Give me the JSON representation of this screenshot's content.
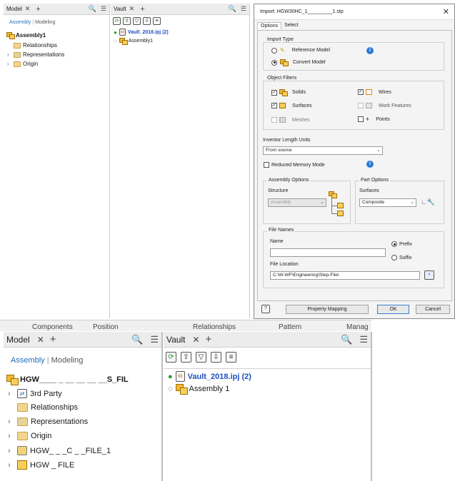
{
  "top": {
    "model_panel": {
      "tab_label": "Model",
      "modes": [
        "Assembly",
        "Modeling"
      ],
      "tree": [
        {
          "label": "Assembly1",
          "icon": "assembly-icon"
        },
        {
          "label": "Relationships",
          "icon": "folder-icon"
        },
        {
          "label": "Representations",
          "icon": "representations-icon"
        },
        {
          "label": "Origin",
          "icon": "folder-icon"
        }
      ]
    },
    "vault_panel": {
      "tab_label": "Vault",
      "project": "Vault_2018.ipj (2)",
      "assembly": "Assembly1"
    },
    "dialog": {
      "title": "Import: HGW30HC_1_________1.stp",
      "tabs": [
        "Options",
        "Select"
      ],
      "import_type": {
        "label": "Import Type",
        "reference_model": "Reference Model",
        "convert_model": "Convert Model"
      },
      "object_filters": {
        "label": "Object Filters",
        "solids": "Solids",
        "surfaces": "Surfaces",
        "meshes": "Meshes",
        "wires": "Wires",
        "work_features": "Work Features",
        "points": "Points"
      },
      "length_units_label": "Inventor Length Units",
      "length_units_value": "From source",
      "reduced_memory": "Reduced Memory Mode",
      "assembly_options": {
        "label": "Assembly Options",
        "structure_label": "Structure",
        "structure_value": "Assembly"
      },
      "part_options": {
        "label": "Part Options",
        "surfaces_label": "Surfaces",
        "surfaces_value": "Composite"
      },
      "file_names": {
        "label": "File Names",
        "name_label": "Name",
        "prefix": "Prefix",
        "suffix": "Suffix",
        "location_label": "File Location",
        "location_value": "C:\\W-WF\\Engineering\\Step-File\\"
      },
      "buttons": {
        "property_mapping": "Property Mapping",
        "ok": "OK",
        "cancel": "Cancel"
      }
    }
  },
  "bottom": {
    "header_fragments": [
      "Components",
      "Position",
      "Relationships",
      "Pattern",
      "Manag"
    ],
    "model_panel": {
      "tab_label": "Model",
      "modes": [
        "Assembly",
        "Modeling"
      ],
      "tree": [
        {
          "label": "HGW____ _ __ __ __ __S_FIL",
          "icon": "assembly-icon"
        },
        {
          "label": "3rd Party",
          "icon": "third-party-icon"
        },
        {
          "label": "Relationships",
          "icon": "folder-icon"
        },
        {
          "label": "Representations",
          "icon": "representations-icon"
        },
        {
          "label": "Origin",
          "icon": "folder-icon"
        },
        {
          "label": "HGW_  _ _C _              _FILE_1",
          "icon": "part-icon"
        },
        {
          "label": "HGW                         _ FILE",
          "icon": "part-icon"
        }
      ]
    },
    "vault_panel": {
      "tab_label": "Vault",
      "project": "Vault_2018.ipj (2)",
      "assembly": "Assembly 1"
    }
  }
}
